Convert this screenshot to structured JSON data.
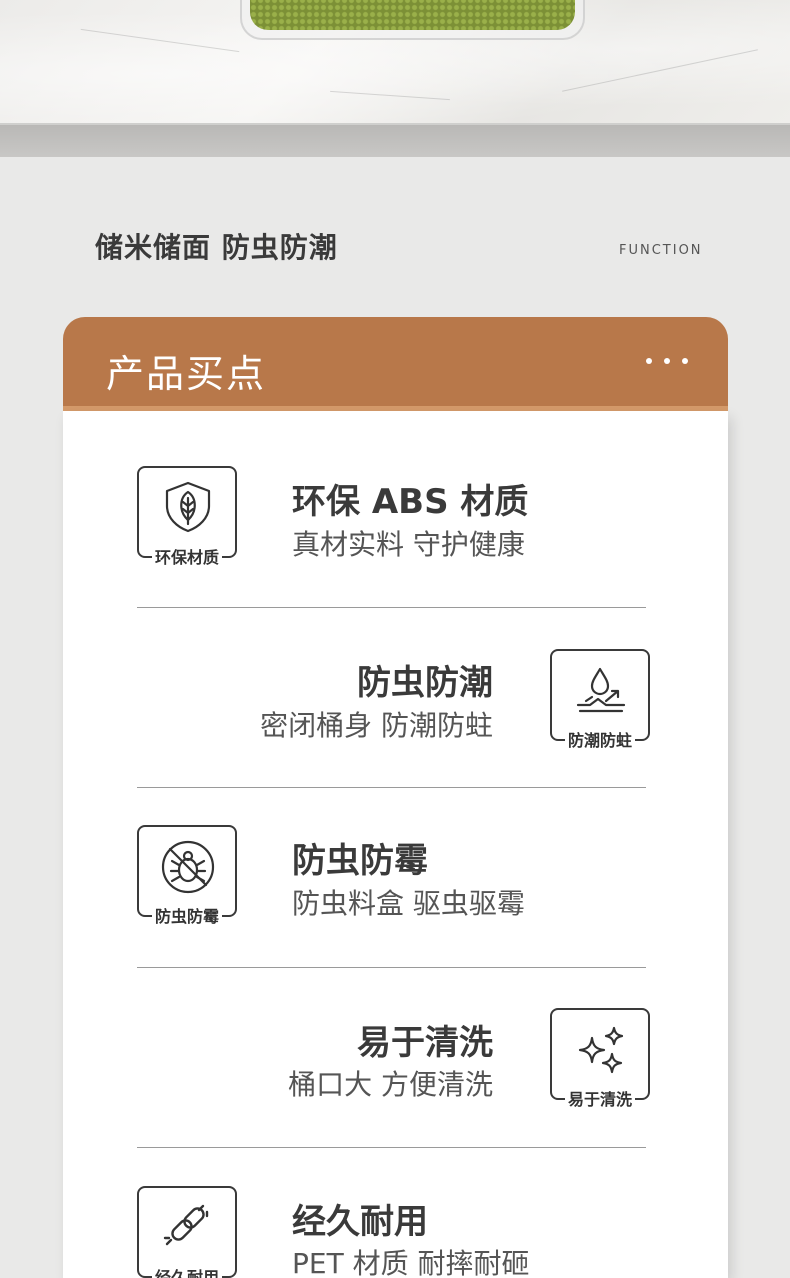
{
  "section": {
    "title": "储米储面 防虫防潮",
    "subtitle": "FUNCTION"
  },
  "card": {
    "header_title": "产品买点"
  },
  "features": [
    {
      "icon": "leaf-shield-icon",
      "icon_label": "环保材质",
      "title": "环保 ABS 材质",
      "desc": "真材实料 守护健康"
    },
    {
      "icon": "water-drop-icon",
      "icon_label": "防潮防蛀",
      "title": "防虫防潮",
      "desc": "密闭桶身 防潮防蛀"
    },
    {
      "icon": "no-bug-icon",
      "icon_label": "防虫防霉",
      "title": "防虫防霉",
      "desc": "防虫料盒 驱虫驱霉"
    },
    {
      "icon": "sparkle-icon",
      "icon_label": "易于清洗",
      "title": "易于清洗",
      "desc": "桶口大 方便清洗"
    },
    {
      "icon": "chain-link-icon",
      "icon_label": "经久耐用",
      "title": "经久耐用",
      "desc": "PET 材质 耐摔耐砸"
    }
  ],
  "colors": {
    "accent": "#b8784a",
    "accent_stripe": "#d49a6a",
    "text_dark": "#3a3a3a",
    "background": "#e9e9e8"
  }
}
